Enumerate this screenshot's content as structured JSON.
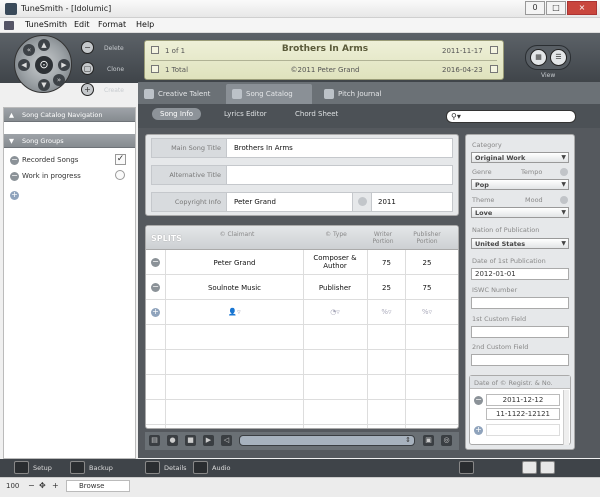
{
  "window": {
    "title": "TuneSmith - [Idolumic]",
    "minimize": "0",
    "maximize": "□",
    "close": "×"
  },
  "menu": [
    "TuneSmith",
    "Edit",
    "Format",
    "Help"
  ],
  "toolbar": {
    "delete_label": "Delete",
    "clone_label": "Clone",
    "create_label": "Create",
    "view_label": "View",
    "nav_center": "⊙"
  },
  "info": {
    "position": "1 of 1",
    "total": "1 Total",
    "song_title": "Brothers In Arms",
    "copyright_line": "©2011 Peter Grand",
    "date_created": "2011-11-17",
    "date_modified": "2016-04-23"
  },
  "left_panel": {
    "nav_header": "Song Catalog Navigation",
    "groups_header": "Song Groups",
    "groups": [
      {
        "label": "Recorded Songs",
        "checked": true
      },
      {
        "label": "Work in progress",
        "checked": false
      }
    ]
  },
  "tabs": [
    {
      "label": "Creative Talent",
      "active": false
    },
    {
      "label": "Song Catalog",
      "active": true
    },
    {
      "label": "Pitch Journal",
      "active": false
    }
  ],
  "subtabs": [
    {
      "label": "Song Info",
      "active": true
    },
    {
      "label": "Lyrics Editor",
      "active": false
    },
    {
      "label": "Chord Sheet",
      "active": false
    }
  ],
  "search": {
    "placeholder": "",
    "icon": "search-icon"
  },
  "form": {
    "main_title_label": "Main Song Title",
    "main_title_value": "Brothers In Arms",
    "alt_title_label": "Alternative Title",
    "alt_title_value": "",
    "copyright_label": "Copyright Info",
    "copyright_value": "Peter Grand",
    "copyright_year": "2011"
  },
  "splits": {
    "title": "SPLITS",
    "headers": {
      "claimant": "© Claimant",
      "type": "© Type",
      "writer": "Writer Portion",
      "publisher": "Publisher Portion"
    },
    "rows": [
      {
        "claimant": "Peter Grand",
        "type": "Composer & Author",
        "writer": "75",
        "publisher": "25"
      },
      {
        "claimant": "Soulnote Music",
        "type": "Publisher",
        "writer": "25",
        "publisher": "75"
      }
    ]
  },
  "right_panel": {
    "category_label": "Category",
    "category_value": "Original Work",
    "genre_label": "Genre",
    "tempo_label": "Tempo",
    "genre_value": "Pop",
    "theme_label": "Theme",
    "mood_label": "Mood",
    "theme_value": "Love",
    "nation_label": "Nation of Publication",
    "nation_value": "United States",
    "pub_date_label": "Date of 1st Publication",
    "pub_date_value": "2012-01-01",
    "iswc_label": "ISWC Number",
    "iswc_value": "",
    "custom1_label": "1st Custom Field",
    "custom1_value": "",
    "custom2_label": "2nd Custom Field",
    "custom2_value": "",
    "reg_label": "Date of © Registr. & No.",
    "reg_date": "2011-12-12",
    "reg_number": "11-1122-12121"
  },
  "statusbar": {
    "setup": "Setup",
    "backup": "Backup",
    "details": "Details",
    "audio": "Audio"
  },
  "bottombar": {
    "zoom": "100",
    "mode": "Browse"
  }
}
